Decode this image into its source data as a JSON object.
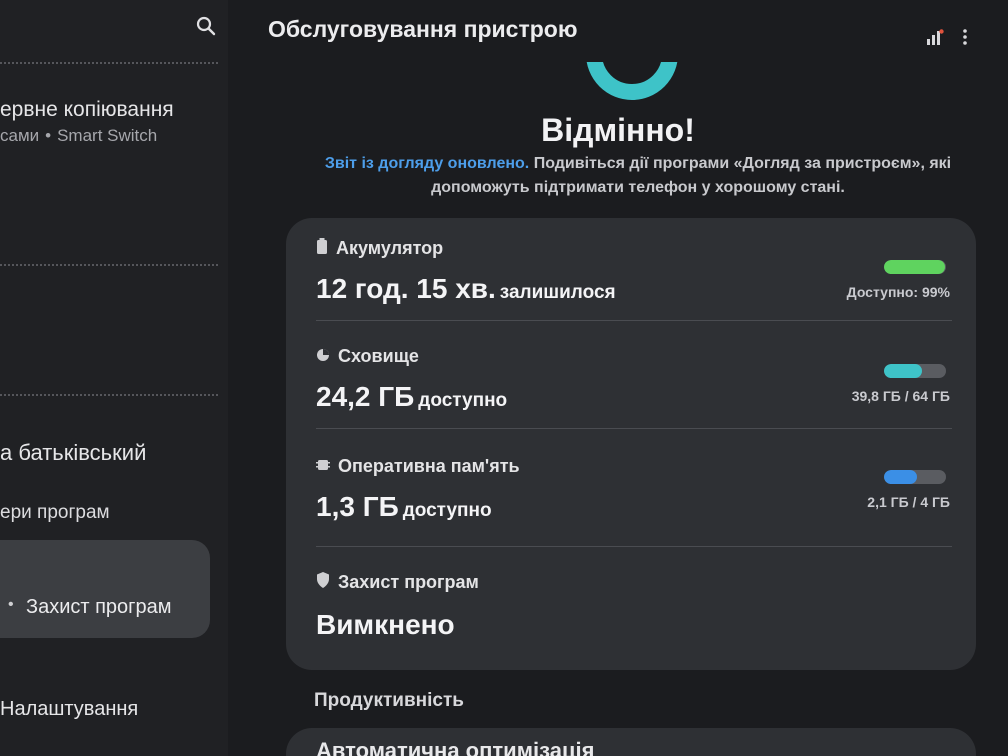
{
  "left_pane": {
    "backup_title": "ервне копіювання",
    "backup_sub_a": "сами",
    "backup_sub_b": "Smart Switch",
    "parental_title": "а батьківський",
    "parental_sub": "ери програм",
    "selected_item": "Захист програм",
    "settings_item": "Налаштування"
  },
  "header": {
    "title": "Обслуговування пристрою"
  },
  "status": {
    "title": "Відмінно!",
    "report_link": "Звіт із догляду оновлено.",
    "report_text": "Подивіться дії програми «Догляд за пристроєм», які допоможуть підтримати телефон у хорошому стані."
  },
  "card": {
    "battery": {
      "label": "Акумулятор",
      "value": "12 год. 15 хв.",
      "suffix": "залишилося",
      "caption": "Доступно: 99%",
      "level": 0.99,
      "color": "#5fd35f"
    },
    "storage": {
      "label": "Сховище",
      "value": "24,2 ГБ",
      "suffix": "доступно",
      "caption": "39,8 ГБ / 64 ГБ",
      "level": 0.62,
      "color": "#3ec3c8"
    },
    "ram": {
      "label": "Оперативна пам'ять",
      "value": "1,3 ГБ",
      "suffix": "доступно",
      "caption": "2,1 ГБ / 4 ГБ",
      "level": 0.525,
      "color": "#3b8fe6"
    },
    "protection": {
      "label": "Захист програм",
      "value": "Вимкнено"
    }
  },
  "sections": {
    "performance": "Продуктивність",
    "auto_optimization": "Автоматична оптимізація"
  },
  "icons": {
    "search": "search-icon",
    "stats": "stats-icon",
    "more": "more-vertical-icon",
    "battery": "battery-icon",
    "storage": "storage-icon",
    "ram": "memory-chip-icon",
    "protection": "shield-icon"
  }
}
